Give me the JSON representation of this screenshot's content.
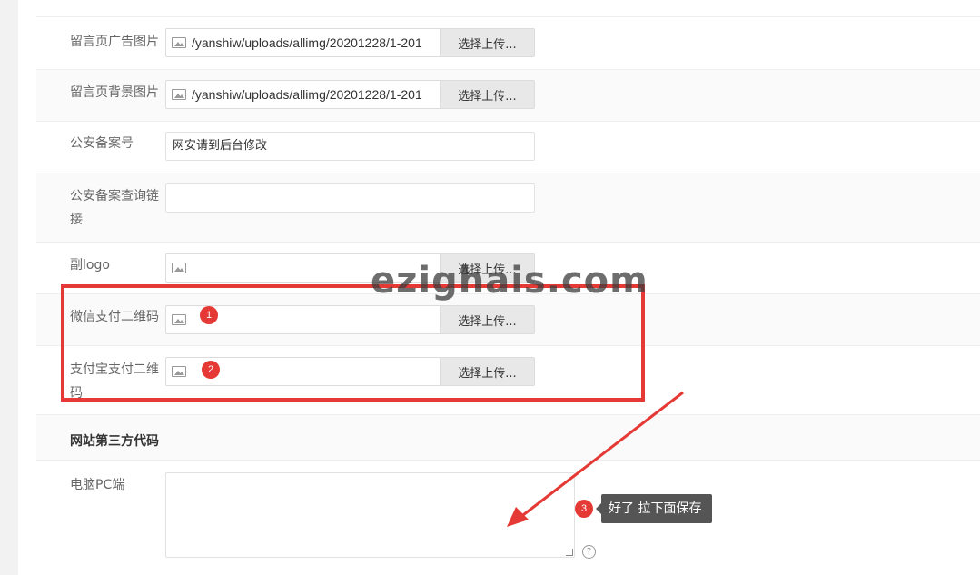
{
  "form": {
    "rows": [
      {
        "label": "留言页广告图片",
        "path": "/yanshiw/uploads/allimg/20201228/1-201",
        "button": "选择上传..."
      },
      {
        "label": "留言页背景图片",
        "path": "/yanshiw/uploads/allimg/20201228/1-201",
        "button": "选择上传..."
      },
      {
        "label": "公安备案号",
        "value": "网安请到后台修改"
      },
      {
        "label": "公安备案查询链接",
        "value": ""
      },
      {
        "label": "副logo",
        "path": "",
        "button": "选择上传..."
      },
      {
        "label": "微信支付二维码",
        "path": "",
        "button": "选择上传..."
      },
      {
        "label": "支付宝支付二维码",
        "path": "",
        "button": "选择上传..."
      }
    ],
    "section_title": "网站第三方代码",
    "pc_label": "电脑PC端",
    "help": "?"
  },
  "annotations": {
    "badge1": "1",
    "badge2": "2",
    "badge3": "3",
    "tip": "好了 拉下面保存",
    "watermark": "ezighais.com",
    "color": "#e53935"
  }
}
